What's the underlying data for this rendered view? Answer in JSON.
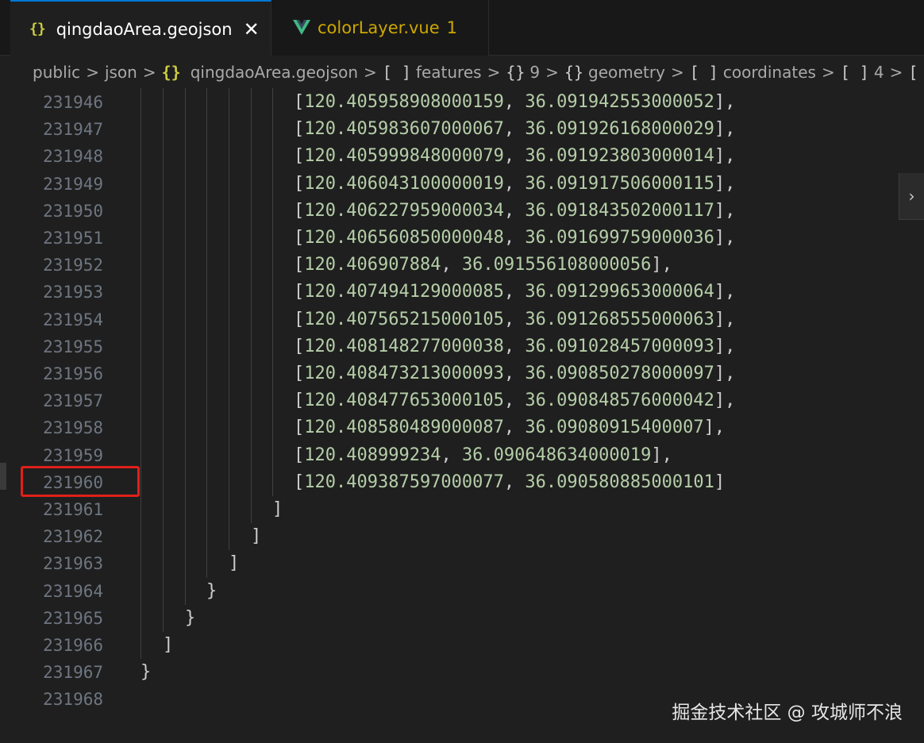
{
  "tabs": [
    {
      "icon": "json-braces-icon",
      "icon_text": "{}",
      "label": "qingdaoArea.geojson",
      "active": true,
      "close": "✕"
    },
    {
      "icon": "vue-icon",
      "label": "colorLayer.vue",
      "badge": "1",
      "active": false
    }
  ],
  "breadcrumb": [
    {
      "icon_text": "",
      "label": "public"
    },
    {
      "icon_text": "",
      "label": "json"
    },
    {
      "icon_text": "{}",
      "label": "qingdaoArea.geojson"
    },
    {
      "icon_text": "[ ]",
      "label": "features"
    },
    {
      "icon_text": "{}",
      "label": "9"
    },
    {
      "icon_text": "{}",
      "label": "geometry"
    },
    {
      "icon_text": "[ ]",
      "label": "coordinates"
    },
    {
      "icon_text": "[ ]",
      "label": "4"
    },
    {
      "icon_text": "[",
      "label": ""
    }
  ],
  "breadcrumb_separator": ">",
  "editor": {
    "lines": [
      {
        "number": "231946",
        "lon": "120.405958908000159",
        "lat": "36.091942553000052",
        "comma": true
      },
      {
        "number": "231947",
        "lon": "120.405983607000067",
        "lat": "36.091926168000029",
        "comma": true
      },
      {
        "number": "231948",
        "lon": "120.405999848000079",
        "lat": "36.091923803000014",
        "comma": true
      },
      {
        "number": "231949",
        "lon": "120.406043100000019",
        "lat": "36.091917506000115",
        "comma": true
      },
      {
        "number": "231950",
        "lon": "120.406227959000034",
        "lat": "36.091843502000117",
        "comma": true
      },
      {
        "number": "231951",
        "lon": "120.406560850000048",
        "lat": "36.091699759000036",
        "comma": true
      },
      {
        "number": "231952",
        "lon": "120.406907884",
        "lat": "36.091556108000056",
        "comma": true
      },
      {
        "number": "231953",
        "lon": "120.407494129000085",
        "lat": "36.091299653000064",
        "comma": true
      },
      {
        "number": "231954",
        "lon": "120.407565215000105",
        "lat": "36.091268555000063",
        "comma": true
      },
      {
        "number": "231955",
        "lon": "120.408148277000038",
        "lat": "36.091028457000093",
        "comma": true
      },
      {
        "number": "231956",
        "lon": "120.408473213000093",
        "lat": "36.090850278000097",
        "comma": true
      },
      {
        "number": "231957",
        "lon": "120.408477653000105",
        "lat": "36.090848576000042",
        "comma": true
      },
      {
        "number": "231958",
        "lon": "120.408580489000087",
        "lat": "36.09080915400007",
        "comma": true
      },
      {
        "number": "231959",
        "lon": "120.408999234",
        "lat": "36.090648634000019",
        "comma": true
      },
      {
        "number": "231960",
        "lon": "120.409387597000077",
        "lat": "36.090580885000101",
        "comma": false
      }
    ],
    "closing_lines": [
      {
        "number": "231961",
        "text": "]"
      },
      {
        "number": "231962",
        "text": "]"
      },
      {
        "number": "231963",
        "text": "]"
      },
      {
        "number": "231964",
        "text": "}"
      },
      {
        "number": "231965",
        "text": "}"
      },
      {
        "number": "231966",
        "text": "]"
      },
      {
        "number": "231967",
        "text": "}"
      },
      {
        "number": "231968",
        "text": ""
      }
    ],
    "highlighted_line": "231960"
  },
  "sticky_toggle": "›",
  "watermark": "掘金技术社区 @ 攻城师不浪",
  "colors": {
    "accent": "#0078d4",
    "highlight_box": "#e0201a",
    "number": "#b5cea8",
    "vue_green": "#41b883"
  }
}
